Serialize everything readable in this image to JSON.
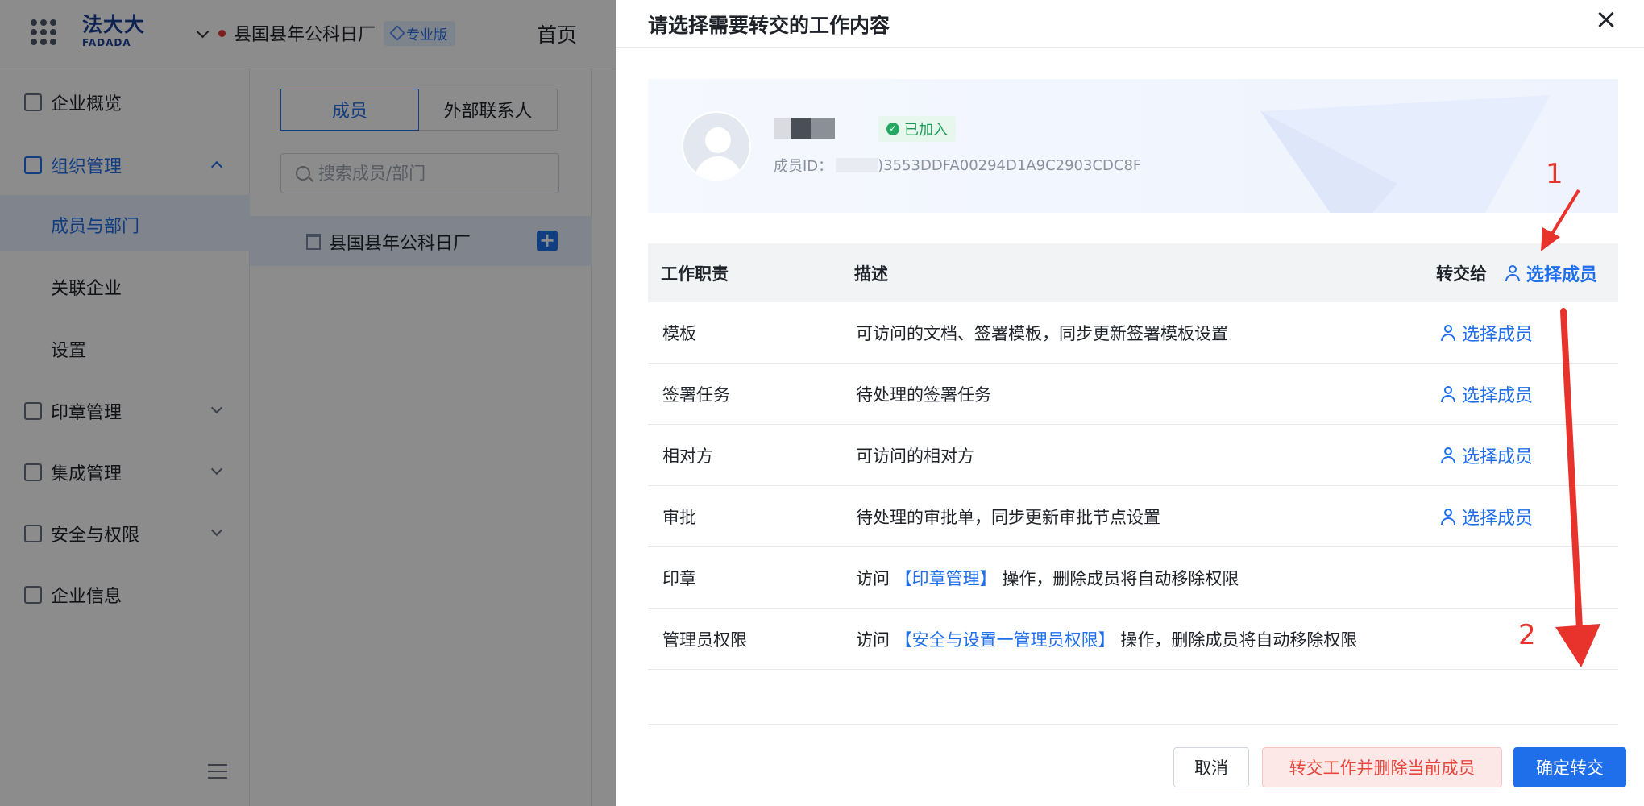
{
  "app": {
    "logo_cn": "法大大",
    "logo_en": "FADADA",
    "org_name": "县国县年公科日厂",
    "edition_badge": "专业版",
    "home_link": "首页"
  },
  "sidebar": {
    "items": [
      {
        "label": "企业概览"
      },
      {
        "label": "组织管理"
      },
      {
        "label": "成员与部门"
      },
      {
        "label": "关联企业"
      },
      {
        "label": "设置"
      },
      {
        "label": "印章管理"
      },
      {
        "label": "集成管理"
      },
      {
        "label": "安全与权限"
      },
      {
        "label": "企业信息"
      }
    ]
  },
  "members_panel": {
    "tab_members": "成员",
    "tab_external": "外部联系人",
    "search_placeholder": "搜索成员/部门",
    "tree_root": "县国县年公科日厂",
    "add_symbol": "+"
  },
  "drawer": {
    "title": "请选择需要转交的工作内容",
    "close_symbol": "×",
    "member": {
      "joined_badge": "已加入",
      "id_label": "成员ID：",
      "id_value": ")3553DDFA00294D1A9C2903CDC8F"
    },
    "table": {
      "headers": {
        "duty": "工作职责",
        "description": "描述",
        "transfer_to": "转交给",
        "select_all": "选择成员"
      },
      "select_label": "选择成员",
      "rows": [
        {
          "duty": "模板",
          "desc": "可访问的文档、签署模板，同步更新签署模板设置"
        },
        {
          "duty": "签署任务",
          "desc": "待处理的签署任务"
        },
        {
          "duty": "相对方",
          "desc": "可访问的相对方"
        },
        {
          "duty": "审批",
          "desc": "待处理的审批单，同步更新审批节点设置"
        },
        {
          "duty": "印章",
          "desc_prefix": "访问 ",
          "desc_link": "【印章管理】",
          "desc_suffix": " 操作，删除成员将自动移除权限"
        },
        {
          "duty": "管理员权限",
          "desc_prefix": "访问 ",
          "desc_link": "【安全与设置一管理员权限】",
          "desc_suffix": " 操作，删除成员将自动移除权限"
        }
      ]
    },
    "annotations": {
      "one": "1",
      "two": "2",
      "color": "#e8322c"
    },
    "buttons": {
      "cancel": "取消",
      "transfer_delete": "转交工作并删除当前成员",
      "confirm": "确定转交"
    }
  },
  "colors": {
    "primary": "#1f6feb",
    "danger": "#e8453c",
    "success": "#1a9b55"
  }
}
